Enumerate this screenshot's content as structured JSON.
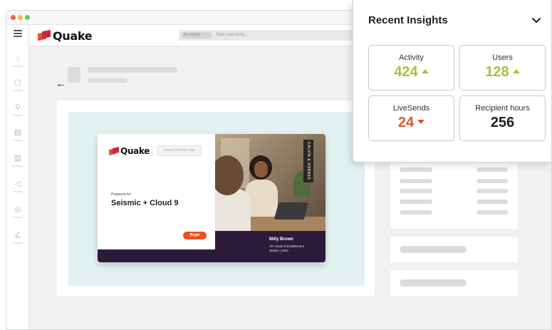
{
  "colors": {
    "accent_orange": "#e8531f",
    "accent_green": "#a7c43a",
    "brand_red": "#c6283a",
    "deep_purple": "#2c1a3b"
  },
  "app": {
    "logo_text": "Quake"
  },
  "search": {
    "chip_label": "All content",
    "placeholder": "Start searching..."
  },
  "sidebar": {
    "icons": [
      "home-icon",
      "notes-icon",
      "wrench-icon",
      "inbox-icon",
      "analytics-icon",
      "send-icon",
      "help-icon",
      "signature-icon"
    ]
  },
  "preview": {
    "logo_text": "Quake",
    "insert_label": "Insert Content Logo",
    "prepared_for": "Prepared for:",
    "recipient": "Seismic + Cloud 9",
    "begin_label": "Begin",
    "sign_text": "CALVIN & HOBBES",
    "presenter_name": "Milly Brown",
    "presenter_role": "VP, Head of Enablement",
    "presenter_company": "Quake | 2022"
  },
  "insights": {
    "title": "Recent Insights",
    "chevron": "chevron-down-icon",
    "stats": [
      {
        "label": "Activity",
        "value": "424",
        "trend": "up"
      },
      {
        "label": "Users",
        "value": "128",
        "trend": "up"
      },
      {
        "label": "LiveSends",
        "value": "24",
        "trend": "down"
      },
      {
        "label": "Recipient hours",
        "value": "256",
        "trend": "none"
      }
    ]
  }
}
